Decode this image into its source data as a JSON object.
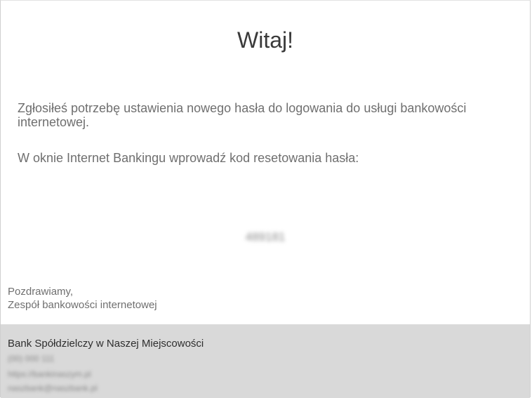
{
  "email": {
    "heading": "Witaj!",
    "paragraph1": "Zgłosiłeś potrzebę ustawienia nowego hasła do logowania do usługi bankowości internetowej.",
    "paragraph2": "W oknie Internet Bankingu wprowadź kod resetowania hasła:",
    "reset_code": "489181",
    "signoff": {
      "line1": "Pozdrawiamy,",
      "line2": "Zespół bankowości internetowej"
    }
  },
  "footer": {
    "bank_name": "Bank Spółdzielczy w Naszej Miejscowości",
    "phone": "(00) 000 111",
    "website": "https://bankinaszym.pl",
    "email": "naszbank@naszbank.pl",
    "background_color": "#d9d9d9"
  }
}
